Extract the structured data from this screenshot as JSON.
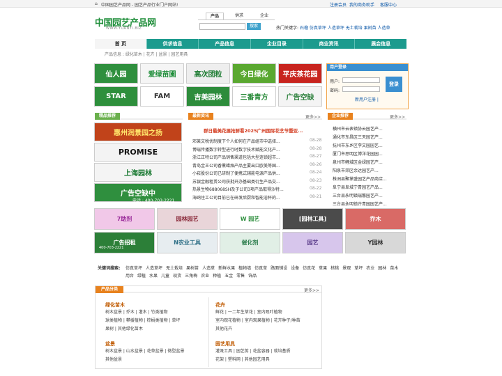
{
  "topbar": {
    "left": "中国园艺产品网 - 园艺产品行业门户网站!",
    "register": "注册会员",
    "helper": "我的商务助手",
    "service": "客服中心"
  },
  "logo": {
    "cn": "中国园艺产品网",
    "en": "WWW.YUANYI.BIZ"
  },
  "search": {
    "tabs": [
      "产品",
      "供求",
      "企业"
    ],
    "placeholder": "",
    "button": "搜索",
    "hot_label": "热门关键字:",
    "hot": [
      "石榴",
      "仿真草坪",
      "人造草坪",
      "无土栽培",
      "果树苗",
      "人造草"
    ]
  },
  "nav": [
    "首 页",
    "供求信息",
    "产品信息",
    "企业目录",
    "商业资讯",
    "展会信息"
  ],
  "crumb": "产品信息 : 绿化苗木 | 花卉 | 盆景 | 园艺用具",
  "tiles": [
    {
      "text": "仙人园",
      "bg": "#2f8f3e"
    },
    {
      "text": "爱绿苗圃",
      "bg": "#f5f5f5",
      "fg": "#1f8e3a"
    },
    {
      "text": "高次团粒",
      "bg": "#eeeeee",
      "fg": "#1a7a2f"
    },
    {
      "text": "今日绿化",
      "bg": "#5aa830"
    },
    {
      "text": "平庆茶花园",
      "bg": "#c8241e"
    },
    {
      "text": "STAR",
      "bg": "#2e8f3c"
    },
    {
      "text": "FAM",
      "bg": "#ffffff",
      "fg": "#333333"
    },
    {
      "text": "吉美园林",
      "bg": "#2d8c3b"
    },
    {
      "text": "三番青方",
      "bg": "#ffffff",
      "fg": "#2b8c3c"
    },
    {
      "text": "广告空缺",
      "bg": "#f4f4f4",
      "fg": "#2a7f3a"
    }
  ],
  "login": {
    "title": "用户登录",
    "user_label": "用户:",
    "pass_label": "密码:",
    "button": "登录",
    "links": "新用户注册 |"
  },
  "featured": {
    "title": "精品推荐",
    "items": [
      {
        "text": "惠州润景园之扬",
        "bg": "#c1431a",
        "fg": "#ffe36a"
      },
      {
        "text": "PROMISE",
        "bg": "#f3f3f3",
        "fg": "#111111"
      },
      {
        "text": "上海园林",
        "bg": "#f4f4f4",
        "fg": "#1b7a33"
      },
      {
        "text": "广告空缺中",
        "bg": "#2f8f3e",
        "fg": "#ffffff"
      }
    ],
    "ad_phone": "电话 : 400-703-2221"
  },
  "news": {
    "title": "最新资讯",
    "more": "更多>>",
    "headline": "群日最美花展抢鲜看2025广州国际花艺节暨亚...",
    "items": [
      {
        "t": "邓莱文税优制度下个人如何在产品组市中选择...",
        "d": "08-28"
      },
      {
        "t": "博瑞传播数字转型进行时数字技术赋能文化产...",
        "d": "08-28"
      },
      {
        "t": "浙江正特公司产品销售渠道包括大型连锁超市...",
        "d": "08-27"
      },
      {
        "t": "青岛金王公司香薰蜡烛产品主要出口欧美等国...",
        "d": "08-26"
      },
      {
        "t": "小崧股份公司已研制了便携式辅能电源产品供...",
        "d": "08-24"
      },
      {
        "t": "苏银金融租赁公司获批开办基础类衍生产品交...",
        "d": "08-23"
      },
      {
        "t": "热景生物688068SH及子公司3项产品取得沙特...",
        "d": "08-22"
      },
      {
        "t": "海鸥住工公司目前已在研发后厨和智能浴杯的...",
        "d": "08-21"
      }
    ]
  },
  "companies": {
    "title": "企业推荐",
    "more": "更多>>",
    "items": [
      "横州市云表镇协云园艺产...",
      "通化市东昌区三天园艺产...",
      "抚州市东乡区李文园园艺...",
      "厦门市思明区博洋花园园...",
      "泉州市鲤城区金绿园艺产...",
      "阳泉市郊区余达园艺产...",
      "株洲县聚掌盛园艺产品商店...",
      "阜宁县阜城宁青园艺产品...",
      "三台县永明镇瑞馨园艺产...",
      "三台县永明镇许青园园艺产..."
    ]
  },
  "ads2": [
    {
      "text": "7助剂",
      "bg": "#f1c8e8",
      "fg": "#9a2b9a"
    },
    {
      "text": "园林园艺",
      "bg": "#e9d5d9",
      "fg": "#8a2a3a"
    },
    {
      "text": "W 园艺",
      "bg": "#ffffff",
      "fg": "#2e8f3e"
    },
    {
      "text": "[园林工具]",
      "bg": "#4b4b4b",
      "fg": "#ffffff"
    },
    {
      "text": "乔木",
      "bg": "#d96a66",
      "fg": "#ffffff"
    },
    {
      "text": "广告招租",
      "bg": "#2c7f38",
      "fg": "#ffffff"
    },
    {
      "text": "N农业工具",
      "bg": "#e7edf0",
      "fg": "#2e6f86"
    },
    {
      "text": "催化剂",
      "bg": "#e1efe6",
      "fg": "#2c7d4c"
    },
    {
      "text": "园艺",
      "bg": "#d7c6ec",
      "fg": "#5a3b8a"
    },
    {
      "text": "Y园林",
      "bg": "#d8d8d8",
      "fg": "#333333"
    }
  ],
  "ad2_phone": "400-703-2221",
  "keywords": {
    "label": "关键词搜索:",
    "items": [
      "仿真草坪",
      "人造草坪",
      "无土栽培",
      "果树苗",
      "人造草",
      "新鲜水果",
      "植物墙",
      "仿真草",
      "路面铺设",
      "设备",
      "仿真花",
      "草果",
      "核桃",
      "景观",
      "草坪",
      "农业",
      "园林",
      "苗木",
      "用台",
      "绿植",
      "水果",
      "儿童",
      "现货",
      "三角梅",
      "农业",
      "种植",
      "五金",
      "零售",
      "饰品"
    ]
  },
  "cats": {
    "title": "产品分类",
    "more": "更多>>",
    "groups": [
      {
        "title": "绿化苗木",
        "lines": [
          "树木盆景 | 乔木 | 灌木 | 竹类植物",
          "球类植物 | 攀援植物 | 棕榈类植物 | 草坪",
          "果树 | 其他绿化苗木"
        ]
      },
      {
        "title": "花卉",
        "lines": [
          "鲜花 | 一二年生草花 | 室内观叶植物",
          "室内观花植物 | 室内观果植物 | 花卉种子/种苗",
          "其他花卉"
        ]
      },
      {
        "title": "盆景",
        "lines": [
          "树木盆景 | 山水盆景 | 花草盆景 | 微型盆景",
          "其他盆景"
        ]
      },
      {
        "title": "园艺用具",
        "lines": [
          "灌溉工具 | 园艺剪 | 花盆容器 | 栽培基质",
          "花架 | 塑料网 | 其他园艺用具"
        ]
      }
    ]
  }
}
